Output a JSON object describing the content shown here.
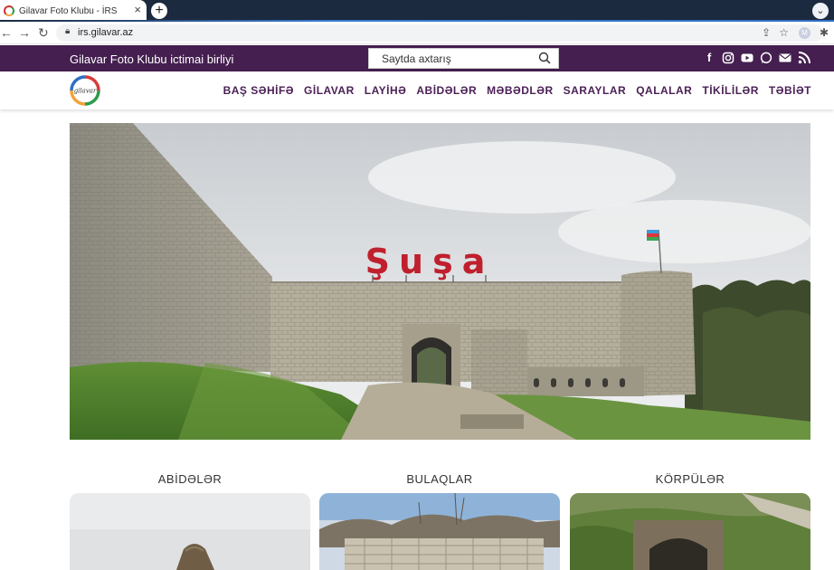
{
  "browser": {
    "tab_title": "Gilavar Foto Klubu - İRS",
    "tab_close": "×",
    "new_tab": "+",
    "tab_menu": "⌄",
    "url": "irs.gilavar.az",
    "profile_letter": "M"
  },
  "site": {
    "brand": "Gilavar Foto Klubu ictimai birliyi",
    "search_placeholder": "Saytda axtarış",
    "social": [
      "facebook-icon",
      "instagram-icon",
      "youtube-icon",
      "whatsapp-icon",
      "mail-icon",
      "rss-icon"
    ],
    "logo_text": "gilavar",
    "menu": [
      "BAŞ SƏHİFƏ",
      "GİLAVAR",
      "LAYİHƏ",
      "ABİDƏLƏR",
      "MƏBƏDLƏR",
      "SARAYLAR",
      "QALALAR",
      "TİKİLİLƏR",
      "TƏBİƏT"
    ],
    "colors": {
      "brand_purple": "#441f4f",
      "menu_text": "#4a1f55",
      "hero_letters": "#c0202e"
    }
  },
  "hero": {
    "sign_text": "Şuşa"
  },
  "categories": [
    {
      "title": "ABİDƏLƏR"
    },
    {
      "title": "BULAQLAR"
    },
    {
      "title": "KÖRPÜLƏR"
    }
  ]
}
